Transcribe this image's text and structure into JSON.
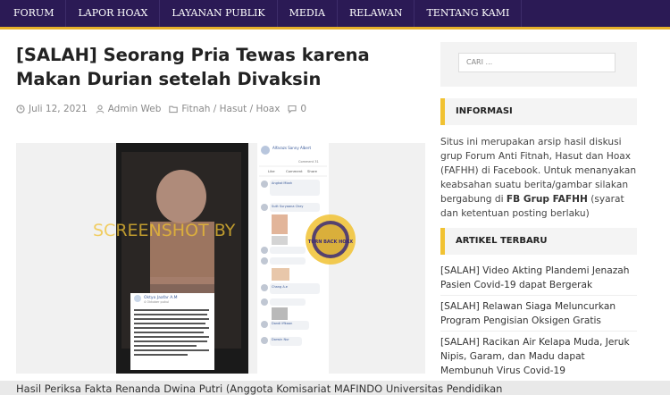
{
  "nav": {
    "items": [
      "FORUM",
      "LAPOR HOAX",
      "LAYANAN PUBLIK",
      "MEDIA",
      "RELAWAN",
      "TENTANG KAMI"
    ]
  },
  "article": {
    "title": "[SALAH] Seorang Pria Tewas karena Makan Durian setelah Divaksin",
    "date": "Juli 12, 2021",
    "author": "Admin Web",
    "category": "Fitnah / Hasut / Hoax",
    "comments": "0",
    "body_start": "Hasil Periksa Fakta Renanda Dwina Putri (Anggota Komisariat MAFINDO Universitas Pendidikan"
  },
  "image": {
    "watermark": "SCREENSHOT BY",
    "badge": "TURN BACK HOAX",
    "left_post": {
      "author": "Oktyo Jaafar A.M",
      "time": "4 Oktober pukul",
      "text": "Berduka keluarga dan rekan-rekan untuk tidak makan durian sebelum atau selepas vaksinasi. Rakan saya di kebun dibeli vaksin dan kembali dan makan durian pada keesokan harinya dan meninggal dunia. Lebih baik mengetahui dan berhati-hati. Hidup itu berharga, karena kejahilan akan membunuhnya dan menyedihkan. Kematian siapa ambil vaksin makan durian"
    },
    "right_post": {
      "author": "Alfarazs Sanny Albert",
      "comments_count": "Comment 31",
      "actions": [
        "Like",
        "Comment",
        "Share"
      ],
      "commenters": [
        "Angkat Mbah",
        "Sulit Suryaana Chey",
        "Chang A.e",
        "Dandi Iffkaan",
        "Darwin Nur"
      ]
    }
  },
  "sidebar": {
    "search_placeholder": "CARI ...",
    "info_heading": "INFORMASI",
    "info_text_1": "Situs ini merupakan arsip hasil diskusi grup Forum Anti Fitnah, Hasut dan Hoax (FAFHH) di Facebook. Untuk menanyakan keabsahan suatu berita/gambar silakan bergabung di ",
    "info_link": "FB Grup FAFHH",
    "info_text_2": " (syarat dan ketentuan posting berlaku)",
    "latest_heading": "ARTIKEL TERBARU",
    "articles": [
      "[SALAH] Video Akting Plandemi Jenazah Pasien Covid-19 dapat Bergerak",
      "[SALAH] Relawan Siaga Meluncurkan Program Pengisian Oksigen Gratis",
      "[SALAH] Racikan Air Kelapa Muda, Jeruk Nipis, Garam, dan Madu dapat Membunuh Virus Covid-19"
    ]
  },
  "colors": {
    "nav_bg": "#2b1a55",
    "accent": "#f1c232"
  }
}
